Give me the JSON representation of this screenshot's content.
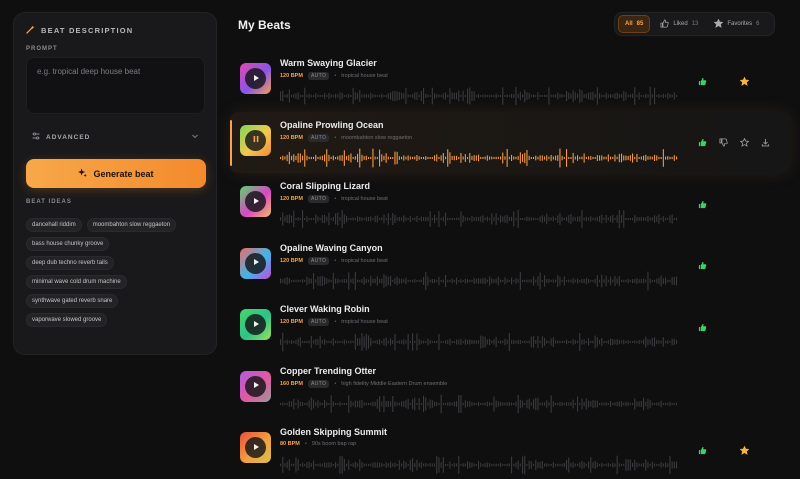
{
  "sidebar": {
    "title": "BEAT DESCRIPTION",
    "prompt_label": "PROMPT",
    "prompt_placeholder": "e.g. tropical deep house beat",
    "prompt_value": "",
    "advanced_label": "ADVANCED",
    "generate_label": "Generate beat",
    "ideas_label": "BEAT IDEAS",
    "ideas": [
      [
        "dancehall riddim",
        "moombahton slow reggaeton"
      ],
      [
        "bass house chunky groove"
      ],
      [
        "deep dub techno reverb tails"
      ],
      [
        "minimal wave cold drum machine"
      ],
      [
        "synthwave gated reverb snare"
      ],
      [
        "vaporwave slowed groove"
      ]
    ]
  },
  "header": {
    "title": "My Beats",
    "filters": [
      {
        "label": "All",
        "count": "85",
        "active": true,
        "icon": ""
      },
      {
        "label": "Liked",
        "count": "13",
        "active": false,
        "icon": "thumb-up-icon"
      },
      {
        "label": "Favorites",
        "count": "6",
        "active": false,
        "icon": "star-icon"
      }
    ]
  },
  "colors": {
    "accent": "#f7a44a",
    "like": "#3fd06a",
    "favorite": "#f2b640"
  },
  "tracks": [
    {
      "title": "Warm Swaying Glacier",
      "bpm": "120 BPM",
      "mode": "AUTO",
      "tag": "tropical house beat",
      "playing": false,
      "liked": true,
      "favorite": true,
      "show_dislike": false,
      "show_download": false,
      "cover": [
        "#e04bb0",
        "#8a54e8",
        "#f2a24d"
      ]
    },
    {
      "title": "Opaline Prowling Ocean",
      "bpm": "120 BPM",
      "mode": "AUTO",
      "tag": "moombahton slow reggaeton",
      "playing": true,
      "liked": true,
      "favorite": false,
      "show_dislike": true,
      "show_download": true,
      "cover": [
        "#7cd75a",
        "#f2c94c",
        "#f08c3a"
      ]
    },
    {
      "title": "Coral Slipping Lizard",
      "bpm": "120 BPM",
      "mode": "AUTO",
      "tag": "tropical house beat",
      "playing": false,
      "liked": true,
      "favorite": false,
      "show_dislike": false,
      "show_download": false,
      "cover": [
        "#5bd66a",
        "#d946c8",
        "#f0c05a"
      ]
    },
    {
      "title": "Opaline Waving Canyon",
      "bpm": "120 BPM",
      "mode": "AUTO",
      "tag": "tropical house beat",
      "playing": false,
      "liked": true,
      "favorite": false,
      "show_dislike": false,
      "show_download": false,
      "cover": [
        "#f06a6a",
        "#3fb6e8",
        "#c64ad8"
      ]
    },
    {
      "title": "Clever Waking Robin",
      "bpm": "120 BPM",
      "mode": "AUTO",
      "tag": "tropical house beat",
      "playing": false,
      "liked": true,
      "favorite": false,
      "show_dislike": false,
      "show_download": false,
      "cover": [
        "#4ad46a",
        "#2bc38a",
        "#9ee05a"
      ]
    },
    {
      "title": "Copper Trending Otter",
      "bpm": "160 BPM",
      "mode": "AUTO",
      "tag": "high fidelity Middle Eastern Drum ensemble",
      "playing": false,
      "liked": false,
      "favorite": false,
      "show_dislike": false,
      "show_download": false,
      "cover": [
        "#b45ae0",
        "#e05aa0",
        "#9a9a9a"
      ]
    },
    {
      "title": "Golden Skipping Summit",
      "bpm": "80 BPM",
      "mode": "",
      "tag": "90s boom bap rap",
      "playing": false,
      "liked": true,
      "favorite": true,
      "show_dislike": false,
      "show_download": false,
      "cover": [
        "#e8503a",
        "#f2a040",
        "#d8c24a"
      ]
    }
  ]
}
